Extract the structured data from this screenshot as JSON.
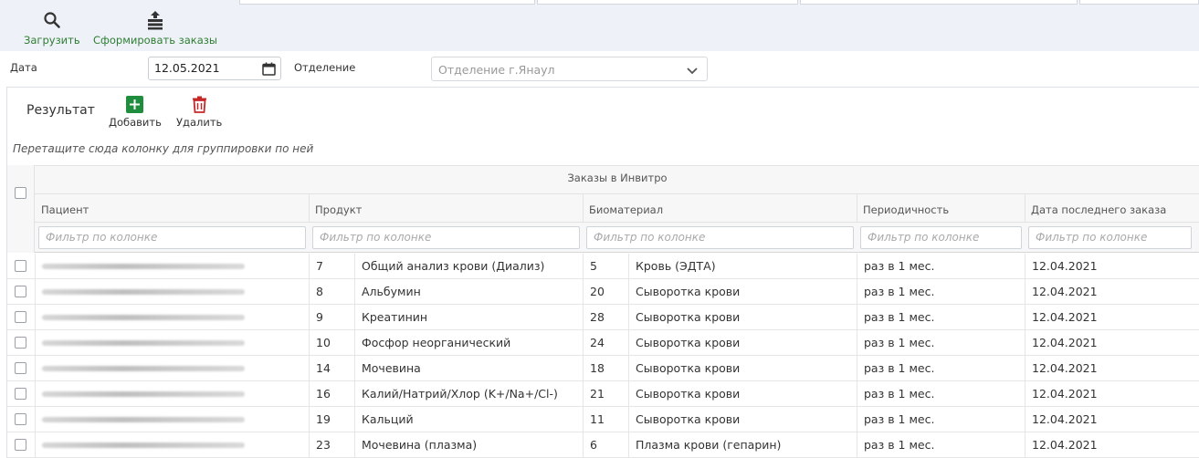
{
  "toolbar": {
    "load_label": "Загрузить",
    "form_orders_label": "Сформировать заказы"
  },
  "filters": {
    "date_label": "Дата",
    "date_value": "12.05.2021",
    "branch_label": "Отделение",
    "branch_value": "Отделение  г.Янаул"
  },
  "result": {
    "title": "Результат",
    "add_label": "Добавить",
    "delete_label": "Удалить",
    "group_hint": "Перетащите сюда колонку для группировки по ней"
  },
  "grid": {
    "band_title": "Заказы в Инвитро",
    "columns": {
      "patient": "Пациент",
      "product": "Продукт",
      "biomaterial": "Биоматериал",
      "periodicity": "Периодичность",
      "last_order_date": "Дата последнего заказа"
    },
    "filter_placeholder": "Фильтр по колонке",
    "rows": [
      {
        "product_id": "7",
        "product": "Общий анализ крови (Диализ)",
        "bio_id": "5",
        "biomaterial": "Кровь (ЭДТА)",
        "periodicity": "раз в 1 мес.",
        "last_date": "12.04.2021"
      },
      {
        "product_id": "8",
        "product": "Альбумин",
        "bio_id": "20",
        "biomaterial": "Сыворотка крови",
        "periodicity": "раз в 1 мес.",
        "last_date": "12.04.2021"
      },
      {
        "product_id": "9",
        "product": "Креатинин",
        "bio_id": "28",
        "biomaterial": "Сыворотка крови",
        "periodicity": "раз в 1 мес.",
        "last_date": "12.04.2021"
      },
      {
        "product_id": "10",
        "product": "Фосфор неорганический",
        "bio_id": "24",
        "biomaterial": "Сыворотка крови",
        "periodicity": "раз в 1 мес.",
        "last_date": "12.04.2021"
      },
      {
        "product_id": "14",
        "product": "Мочевина",
        "bio_id": "18",
        "biomaterial": "Сыворотка крови",
        "periodicity": "раз в 1 мес.",
        "last_date": "12.04.2021"
      },
      {
        "product_id": "16",
        "product": "Калий/Натрий/Хлор (K+/Na+/Cl-)",
        "bio_id": "21",
        "biomaterial": "Сыворотка крови",
        "periodicity": "раз в 1 мес.",
        "last_date": "12.04.2021"
      },
      {
        "product_id": "19",
        "product": "Кальций",
        "bio_id": "11",
        "biomaterial": "Сыворотка крови",
        "periodicity": "раз в 1 мес.",
        "last_date": "12.04.2021"
      },
      {
        "product_id": "23",
        "product": "Мочевина (плазма)",
        "bio_id": "6",
        "biomaterial": "Плазма крови (гепарин)",
        "periodicity": "раз в 1 мес.",
        "last_date": "12.04.2021"
      }
    ]
  },
  "colors": {
    "accent_green": "#2e7d32",
    "add_green": "#1e8e3e",
    "delete_red": "#c62828"
  }
}
